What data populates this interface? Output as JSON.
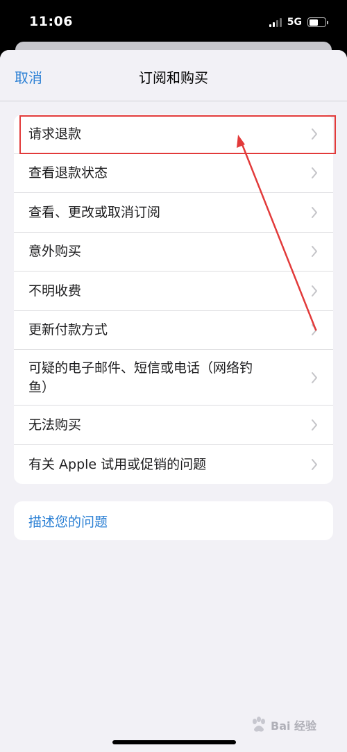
{
  "status": {
    "time": "11:06",
    "network": "5G"
  },
  "nav": {
    "cancel": "取消",
    "title": "订阅和购买"
  },
  "menu": {
    "items": [
      {
        "label": "请求退款"
      },
      {
        "label": "查看退款状态"
      },
      {
        "label": "查看、更改或取消订阅"
      },
      {
        "label": "意外购买"
      },
      {
        "label": "不明收费"
      },
      {
        "label": "更新付款方式"
      },
      {
        "label": "可疑的电子邮件、短信或电话（网络钓鱼）"
      },
      {
        "label": "无法购买"
      },
      {
        "label": "有关 Apple 试用或促销的问题"
      }
    ]
  },
  "describe": {
    "label": "描述您的问题"
  },
  "watermark": {
    "text": "Bai 经验"
  },
  "colors": {
    "accent": "#2a7fd4",
    "highlight": "#e23a3a",
    "background": "#f2f1f6"
  }
}
